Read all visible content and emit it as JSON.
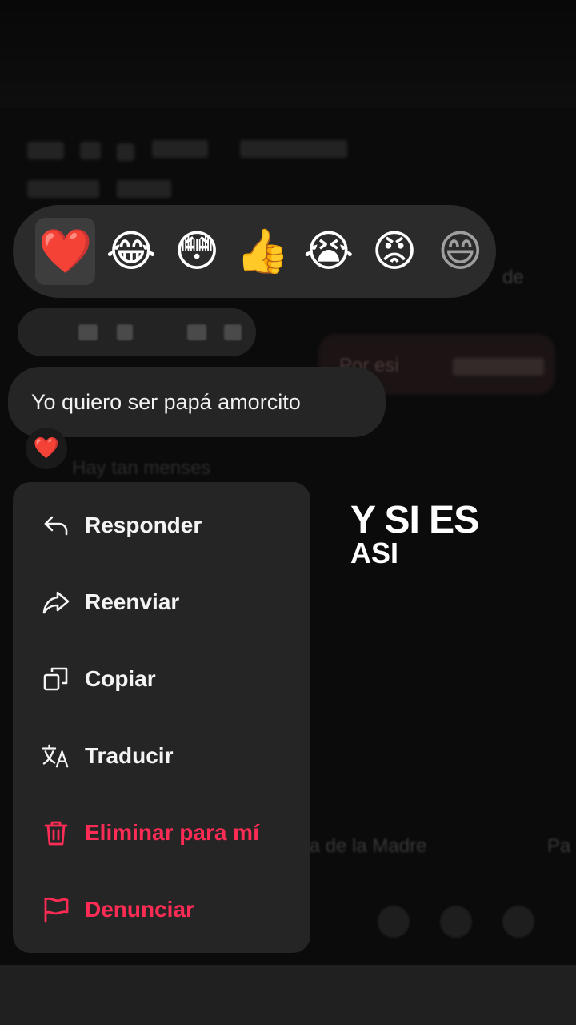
{
  "reactions": [
    {
      "emoji": "❤️",
      "name": "heart"
    },
    {
      "emoji": "😂",
      "name": "laughing-tears"
    },
    {
      "emoji": "😳",
      "name": "flushed"
    },
    {
      "emoji": "👍",
      "name": "thumbs-up"
    },
    {
      "emoji": "😭",
      "name": "crying"
    },
    {
      "emoji": "😡",
      "name": "angry"
    },
    {
      "emoji": "😄",
      "name": "more-partial"
    }
  ],
  "message": {
    "text": "Yo quiero ser papá amorcito",
    "reaction": "❤️"
  },
  "menu": {
    "items": [
      {
        "label": "Responder",
        "icon": "reply-icon",
        "danger": false
      },
      {
        "label": "Reenviar",
        "icon": "forward-icon",
        "danger": false
      },
      {
        "label": "Copiar",
        "icon": "copy-icon",
        "danger": false
      },
      {
        "label": "Traducir",
        "icon": "translate-icon",
        "danger": false
      },
      {
        "label": "Eliminar para mí",
        "icon": "trash-icon",
        "danger": true
      },
      {
        "label": "Denunciar",
        "icon": "flag-icon",
        "danger": true
      }
    ]
  },
  "caption": {
    "line1": "Y SI ES",
    "line2": "ASI"
  },
  "background": {
    "ghost_right_bubble": "Por esi",
    "ghost_hint_1": "de",
    "ghost_hint_2": "Hay tan menses",
    "ghost_suggestion": "ía de la Madre",
    "ghost_suggestion_2": "Pa"
  },
  "colors": {
    "danger": "#fe2c55",
    "menu_bg": "#252525",
    "reaction_bar_bg": "#2b2b2b"
  }
}
